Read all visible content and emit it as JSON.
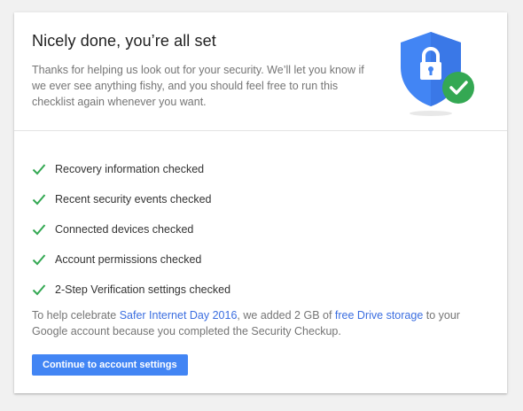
{
  "header": {
    "title": "Nicely done, you’re all set",
    "intro": "Thanks for helping us look out for your security. We’ll let you know if we ever see anything fishy, and you should feel free to run this checklist again whenever you want.",
    "illustration_icon": "shield-lock-check-icon"
  },
  "checklist": [
    {
      "icon": "checkmark-icon",
      "label": "Recovery information checked"
    },
    {
      "icon": "checkmark-icon",
      "label": "Recent security events checked"
    },
    {
      "icon": "checkmark-icon",
      "label": "Connected devices checked"
    },
    {
      "icon": "checkmark-icon",
      "label": "Account permissions checked"
    },
    {
      "icon": "checkmark-icon",
      "label": "2-Step Verification settings checked"
    }
  ],
  "promo": {
    "text_1": "To help celebrate ",
    "link_1": "Safer Internet Day 2016",
    "text_2": ", we added 2 GB of ",
    "link_2": "free Drive storage",
    "text_3": " to your Google account because you completed the Security Checkup."
  },
  "button": {
    "label": "Continue to account settings"
  },
  "colors": {
    "accent_blue": "#4285f4",
    "check_green": "#34a853",
    "link_blue": "#3b6ee0"
  }
}
